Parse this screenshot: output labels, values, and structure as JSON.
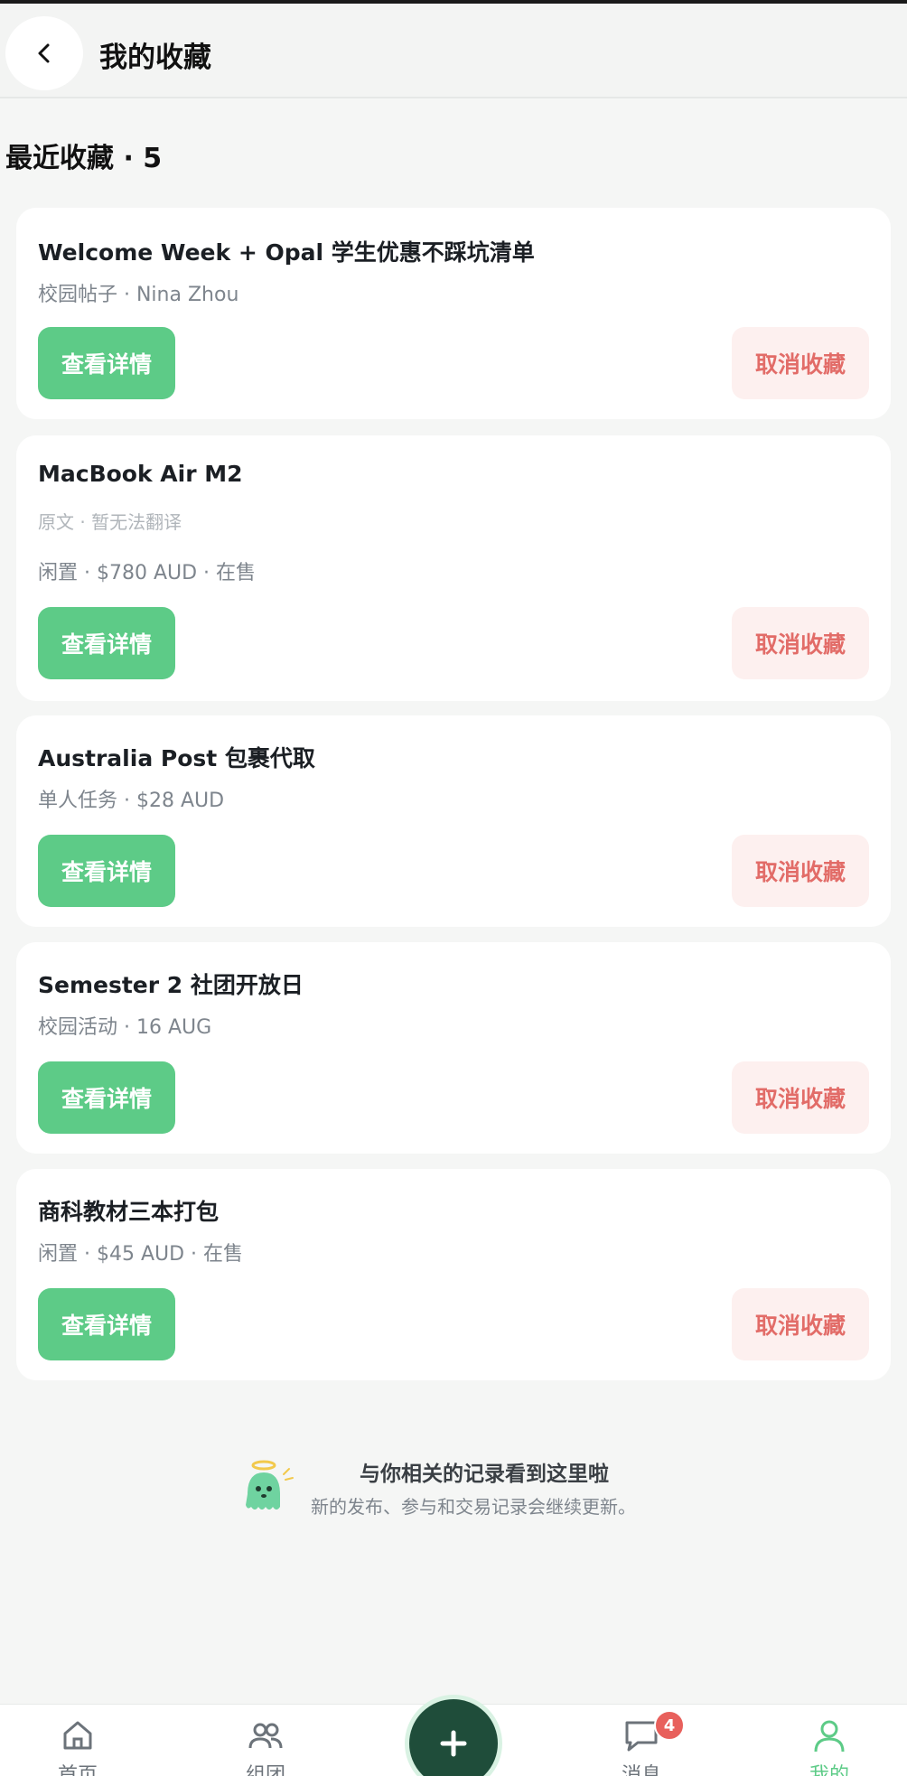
{
  "header": {
    "title": "我的收藏"
  },
  "section": {
    "title": "最近收藏 · 5"
  },
  "cards": [
    {
      "title": "Welcome Week + Opal 学生优惠不踩坑清单",
      "meta": "校园帖子 · Nina Zhou",
      "note": "",
      "view_label": "查看详情",
      "unfav_label": "取消收藏"
    },
    {
      "title": "MacBook Air M2",
      "note": "原文 · 暂无法翻译",
      "meta": "闲置 · $780 AUD · 在售",
      "view_label": "查看详情",
      "unfav_label": "取消收藏"
    },
    {
      "title": "Australia Post 包裹代取",
      "meta": "单人任务 · $28 AUD",
      "note": "",
      "view_label": "查看详情",
      "unfav_label": "取消收藏"
    },
    {
      "title": "Semester 2 社团开放日",
      "meta": "校园活动 · 16 AUG",
      "note": "",
      "view_label": "查看详情",
      "unfav_label": "取消收藏"
    },
    {
      "title": "商科教材三本打包",
      "meta": "闲置 · $45 AUD · 在售",
      "note": "",
      "view_label": "查看详情",
      "unfav_label": "取消收藏"
    }
  ],
  "end_message": {
    "title": "与你相关的记录看到这里啦",
    "subtitle": "新的发布、参与和交易记录会继续更新。"
  },
  "bottom_nav": {
    "items": [
      {
        "label": "首页",
        "icon": "home-icon"
      },
      {
        "label": "组团",
        "icon": "group-icon"
      },
      {
        "label": "消息",
        "icon": "message-icon"
      },
      {
        "label": "我的",
        "icon": "profile-icon"
      }
    ],
    "add_icon": "plus-icon",
    "message_badge": "4",
    "active": "我的"
  },
  "colors": {
    "accent": "#5dcb87",
    "danger": "#e26c68",
    "danger_bg": "#fdf0ef",
    "fab": "#1f4d3a",
    "badge": "#e8605c"
  }
}
